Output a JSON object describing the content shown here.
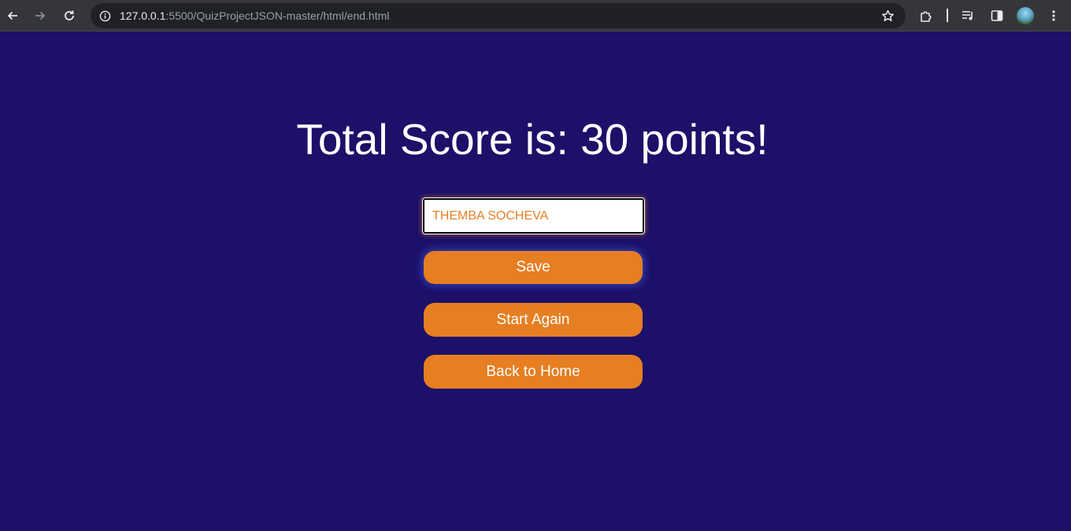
{
  "browser": {
    "url_host": "127.0.0.1",
    "url_path": ":5500/QuizProjectJSON-master/html/end.html"
  },
  "page": {
    "heading": "Total Score is: 30 points!",
    "username_input": {
      "value": "THEMBA SOCHEVA"
    },
    "buttons": {
      "save": "Save",
      "start_again": "Start Again",
      "back_home": "Back to Home"
    }
  },
  "colors": {
    "background": "#1c1068",
    "accent": "#e67e22",
    "text": "#ffffff"
  },
  "icons": [
    "back-arrow-icon",
    "forward-arrow-icon",
    "reload-icon",
    "site-info-icon",
    "bookmark-star-icon",
    "extensions-icon",
    "media-queue-icon",
    "side-panel-icon",
    "profile-avatar",
    "more-menu-icon"
  ]
}
